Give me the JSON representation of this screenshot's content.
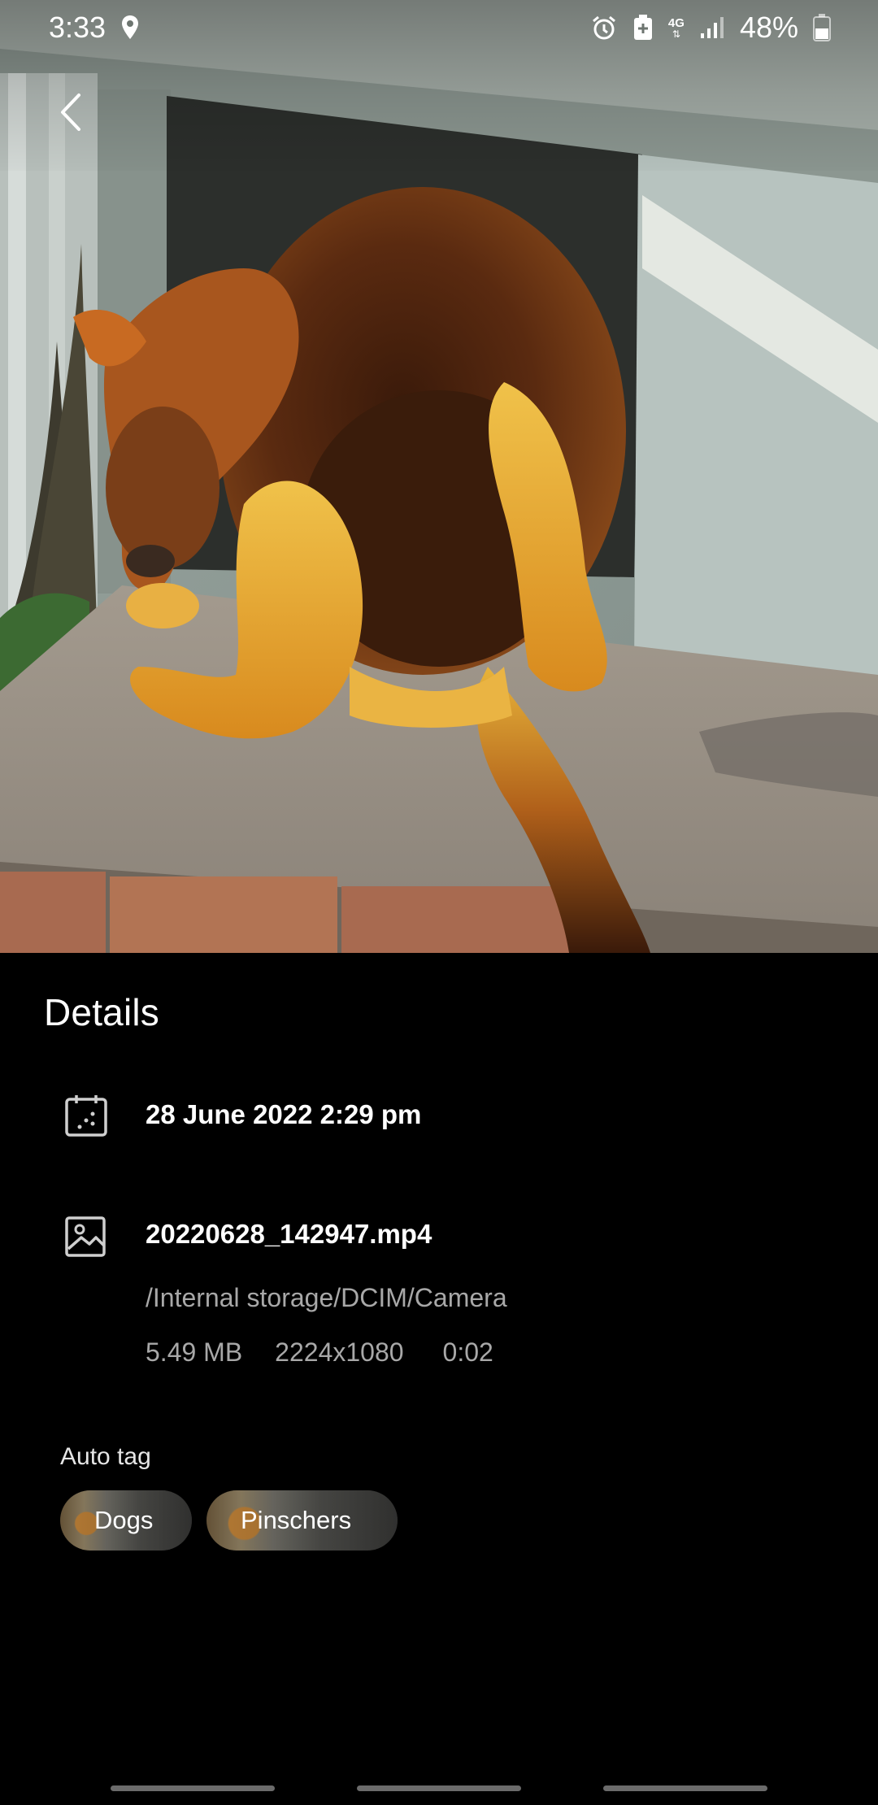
{
  "status_bar": {
    "time": "3:33",
    "battery": "48%",
    "network": "4G"
  },
  "details": {
    "title": "Details",
    "date": "28 June 2022 2:29 pm",
    "file": {
      "name": "20220628_142947.mp4",
      "path": "/Internal storage/DCIM/Camera",
      "size": "5.49 MB",
      "resolution": "2224x1080",
      "duration": "0:02"
    }
  },
  "auto_tag": {
    "label": "Auto tag",
    "tags": [
      "Dogs",
      "Pinschers"
    ]
  },
  "icons": {
    "back": "back-chevron-icon",
    "location": "location-pin-icon",
    "alarm": "alarm-icon",
    "battery_saver": "battery-saver-icon",
    "signal": "signal-icon",
    "battery": "battery-icon",
    "calendar": "calendar-icon",
    "image": "image-icon"
  },
  "colors": {
    "background": "#000000",
    "secondary_text": "#a8a8a8"
  }
}
